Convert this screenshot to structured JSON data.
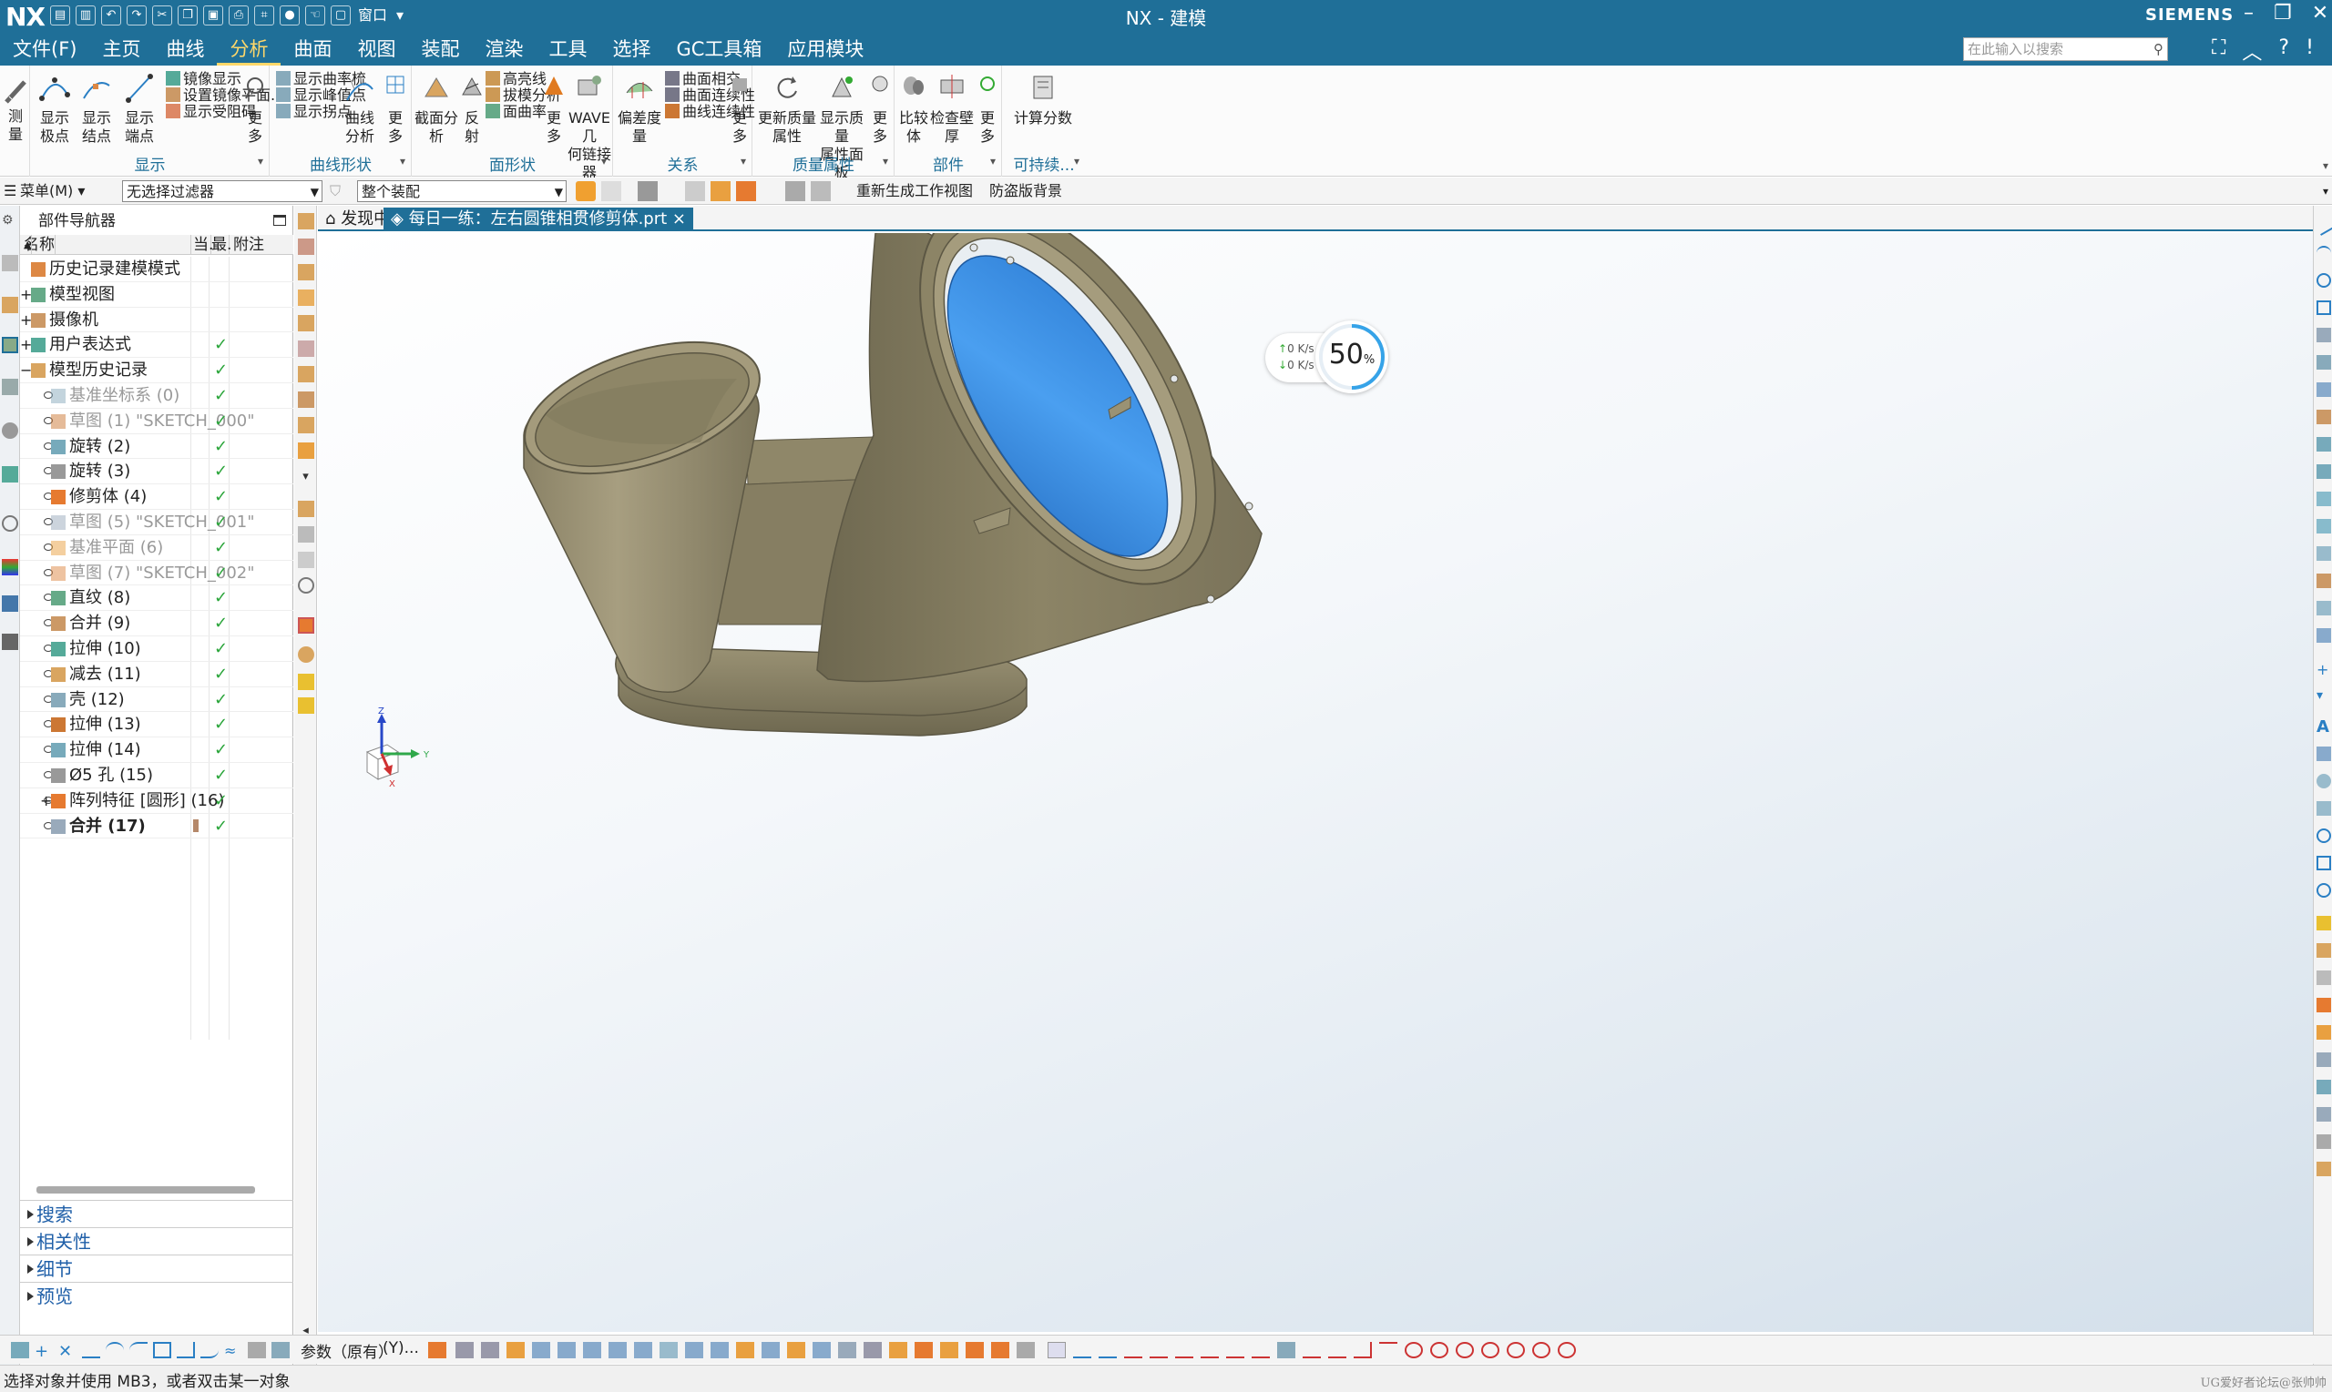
{
  "titlebar": {
    "logo": "NX",
    "title": "NX - 建模",
    "brand": "SIEMENS",
    "window_menu": "窗口"
  },
  "menubar": {
    "tabs": [
      "文件(F)",
      "主页",
      "曲线",
      "分析",
      "曲面",
      "视图",
      "装配",
      "渲染",
      "工具",
      "选择",
      "GC工具箱",
      "应用模块"
    ],
    "active_tab": "分析",
    "search_placeholder": "在此输入以搜索"
  },
  "ribbon": {
    "measure": "测量",
    "display": {
      "label": "显示",
      "buttons": [
        "显示极点",
        "显示结点",
        "显示端点"
      ],
      "small": [
        "镜像显示",
        "设置镜像平面...",
        "显示受阻碍"
      ],
      "more": "更多"
    },
    "curve_shape": {
      "label": "曲线形状",
      "small": [
        "显示曲率梳",
        "显示峰值点",
        "显示拐点"
      ],
      "buttons": [
        "曲线分析"
      ],
      "more": "更多"
    },
    "face_shape": {
      "label": "面形状",
      "buttons": [
        "截面分析",
        "反射"
      ],
      "small": [
        "高亮线",
        "拔模分析",
        "面曲率"
      ],
      "more": "更多",
      "wave_line1": "WAVE 几",
      "wave_line2": "何链接器"
    },
    "relation": {
      "label": "关系",
      "buttons": [
        "偏差度量"
      ],
      "small": [
        "曲面相交",
        "曲面连续性",
        "曲线连续性"
      ],
      "more": "更多"
    },
    "mass": {
      "label": "质量属性",
      "buttons": [
        "更新质量属性"
      ],
      "panel_line1": "显示质量",
      "panel_line2": "属性面板",
      "more": "更多"
    },
    "part": {
      "label": "部件",
      "buttons": [
        "比较体",
        "检查壁厚"
      ],
      "more": "更多"
    },
    "sustain": {
      "label": "可持续...",
      "buttons": [
        "计算分数"
      ]
    }
  },
  "filterbar": {
    "menu": "菜单(M)",
    "filter": "无选择过滤器",
    "assembly": "整个装配",
    "regen": "重新生成工作视图",
    "antialias": "防盗版背景"
  },
  "navigator": {
    "title": "部件导航器",
    "columns": [
      "名称",
      "当.",
      "最.",
      "附注"
    ],
    "rows": [
      {
        "name": "历史记录建模模式",
        "style": "normal",
        "check": false,
        "indent": 12,
        "expand": "",
        "eye": false
      },
      {
        "name": "模型视图",
        "style": "normal",
        "check": false,
        "indent": 12,
        "expand": "+",
        "eye": false
      },
      {
        "name": "摄像机",
        "style": "normal",
        "check": false,
        "indent": 12,
        "expand": "+",
        "eye": false
      },
      {
        "name": "用户表达式",
        "style": "normal",
        "check": true,
        "indent": 12,
        "expand": "+",
        "eye": false
      },
      {
        "name": "模型历史记录",
        "style": "normal",
        "check": true,
        "indent": 12,
        "expand": "−",
        "eye": false
      },
      {
        "name": "基准坐标系 (0)",
        "style": "dim",
        "check": true,
        "indent": 34,
        "expand": "",
        "eye": true
      },
      {
        "name": "草图 (1) \"SKETCH_000\"",
        "style": "dim",
        "check": true,
        "indent": 34,
        "expand": "",
        "eye": true
      },
      {
        "name": "旋转 (2)",
        "style": "normal",
        "check": true,
        "indent": 34,
        "expand": "",
        "eye": true
      },
      {
        "name": "旋转 (3)",
        "style": "normal",
        "check": true,
        "indent": 34,
        "expand": "",
        "eye": true
      },
      {
        "name": "修剪体 (4)",
        "style": "normal",
        "check": true,
        "indent": 34,
        "expand": "",
        "eye": true
      },
      {
        "name": "草图 (5) \"SKETCH_001\"",
        "style": "dim",
        "check": true,
        "indent": 34,
        "expand": "",
        "eye": true
      },
      {
        "name": "基准平面 (6)",
        "style": "dim",
        "check": true,
        "indent": 34,
        "expand": "",
        "eye": true
      },
      {
        "name": "草图 (7) \"SKETCH_002\"",
        "style": "dim",
        "check": true,
        "indent": 34,
        "expand": "",
        "eye": true
      },
      {
        "name": "直纹 (8)",
        "style": "normal",
        "check": true,
        "indent": 34,
        "expand": "",
        "eye": true
      },
      {
        "name": "合并 (9)",
        "style": "normal",
        "check": true,
        "indent": 34,
        "expand": "",
        "eye": true
      },
      {
        "name": "拉伸 (10)",
        "style": "normal",
        "check": true,
        "indent": 34,
        "expand": "",
        "eye": true
      },
      {
        "name": "减去 (11)",
        "style": "normal",
        "check": true,
        "indent": 34,
        "expand": "",
        "eye": true
      },
      {
        "name": "壳 (12)",
        "style": "normal",
        "check": true,
        "indent": 34,
        "expand": "",
        "eye": true
      },
      {
        "name": "拉伸 (13)",
        "style": "normal",
        "check": true,
        "indent": 34,
        "expand": "",
        "eye": true
      },
      {
        "name": "拉伸 (14)",
        "style": "normal",
        "check": true,
        "indent": 34,
        "expand": "",
        "eye": true
      },
      {
        "name": "Ø5 孔 (15)",
        "style": "normal",
        "check": true,
        "indent": 34,
        "expand": "",
        "eye": true
      },
      {
        "name": "阵列特征 [圆形] (16)",
        "style": "normal",
        "check": true,
        "indent": 34,
        "expand": "+",
        "eye": true
      },
      {
        "name": "合并 (17)",
        "style": "bold",
        "check": true,
        "indent": 34,
        "expand": "",
        "eye": true
      }
    ],
    "panels": [
      "搜索",
      "相关性",
      "细节",
      "预览"
    ]
  },
  "doctabs": {
    "discover": "发现中心",
    "active": "每日一练：左右圆锥相贯修剪体.prt",
    "close": "×"
  },
  "viewport": {
    "perf_up": "0  K/s",
    "perf_down": "0  K/s",
    "perf_percent": "50",
    "perf_unit": "%",
    "model_color": "#8c8466",
    "face_color": "#3c8fe0",
    "triad_x": "X",
    "triad_y": "Y",
    "triad_z": "Z"
  },
  "bottombar": {
    "params": "参数（原有）",
    "y_label": "(Y)..."
  },
  "statusbar": {
    "message": "选择对象并使用 MB3，或者双击某一对象",
    "watermark": "UG爱好者论坛@张帅帅"
  }
}
